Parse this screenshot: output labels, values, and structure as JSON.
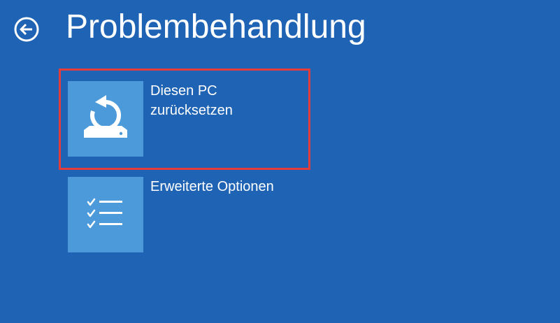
{
  "header": {
    "title": "Problembehandlung",
    "back_icon": "back-arrow-circle-icon"
  },
  "options": [
    {
      "label": "Diesen PC\nzurücksetzen",
      "icon": "reset-pc-icon",
      "highlighted": true
    },
    {
      "label": "Erweiterte Optionen",
      "icon": "checklist-icon",
      "highlighted": false
    }
  ],
  "colors": {
    "background": "#1f63b4",
    "tile": "#4c9ad9",
    "text": "#ffffff",
    "highlight": "#e53b3b"
  }
}
